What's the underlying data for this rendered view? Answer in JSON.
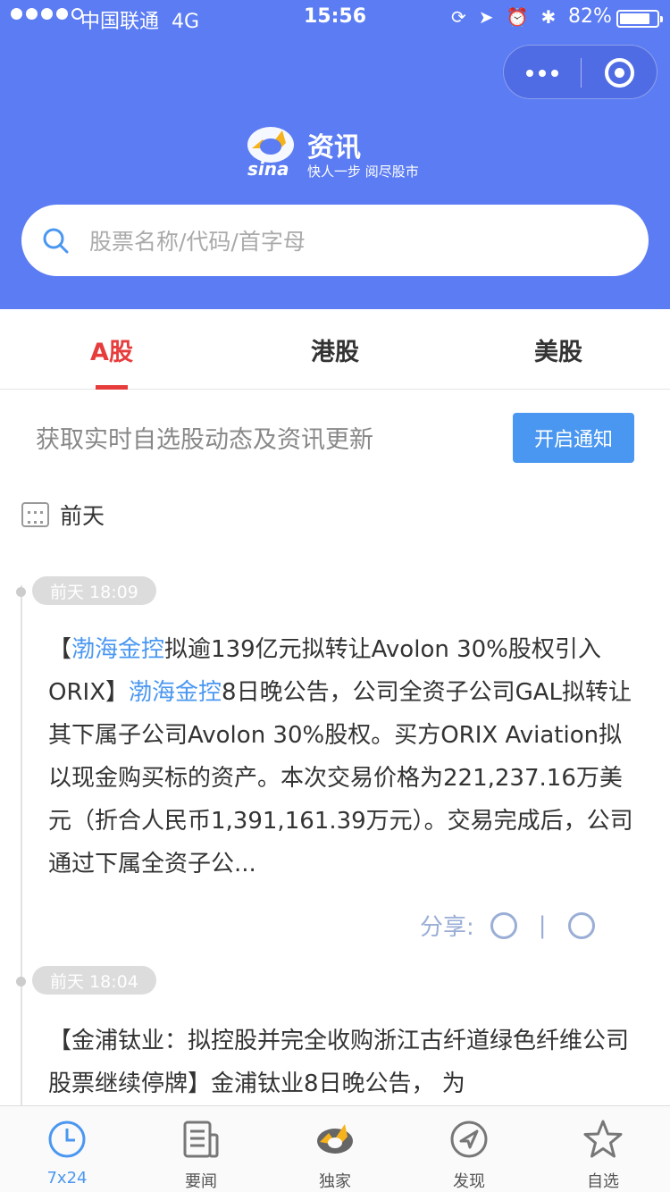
{
  "status_bar": {
    "carrier": "中国联通",
    "network": "4G",
    "time": "15:56",
    "battery_pct": "82%",
    "battery_level": 0.82
  },
  "header": {
    "brand_name": "资讯",
    "brand_slogan": "快人一步 阅尽股市",
    "logo_text": "sina"
  },
  "search": {
    "placeholder": "股票名称/代码/首字母"
  },
  "tabs": [
    {
      "label": "A股",
      "active": true
    },
    {
      "label": "港股",
      "active": false
    },
    {
      "label": "美股",
      "active": false
    }
  ],
  "notify": {
    "text": "获取实时自选股动态及资讯更新",
    "button": "开启通知"
  },
  "date_label": "前天",
  "news": [
    {
      "time": "前天 18:09",
      "p1": "【",
      "link1": "渤海金控",
      "p2": "拟逾139亿元拟转让Avolon 30%股权引入ORIX】",
      "link2": "渤海金控",
      "p3": "8日晚公告，公司全资子公司GAL拟转让其下属子公司Avolon 30%股权。买方ORIX Aviation拟以现金购买标的资产。本次交易价格为221,237.16万美元（折合人民币1,391,161.39万元）。交易完成后，公司通过下属全资子公...",
      "share_label": "分享:"
    },
    {
      "time": "前天 18:04",
      "text": "【金浦钛业：拟控股并完全收购浙江古纤道绿色纤维公司 股票继续停牌】金浦钛业8日晚公告， 为"
    }
  ],
  "bottom_nav": [
    {
      "label": "7x24",
      "active": true,
      "icon": "clock-icon"
    },
    {
      "label": "要闻",
      "active": false,
      "icon": "newspaper-icon"
    },
    {
      "label": "独家",
      "active": false,
      "icon": "sina-eye-icon"
    },
    {
      "label": "发现",
      "active": false,
      "icon": "compass-icon"
    },
    {
      "label": "自选",
      "active": false,
      "icon": "star-icon"
    }
  ],
  "colors": {
    "header_bg": "#5b7cf3",
    "accent_red": "#e73c3c",
    "link_blue": "#4a97f1"
  }
}
